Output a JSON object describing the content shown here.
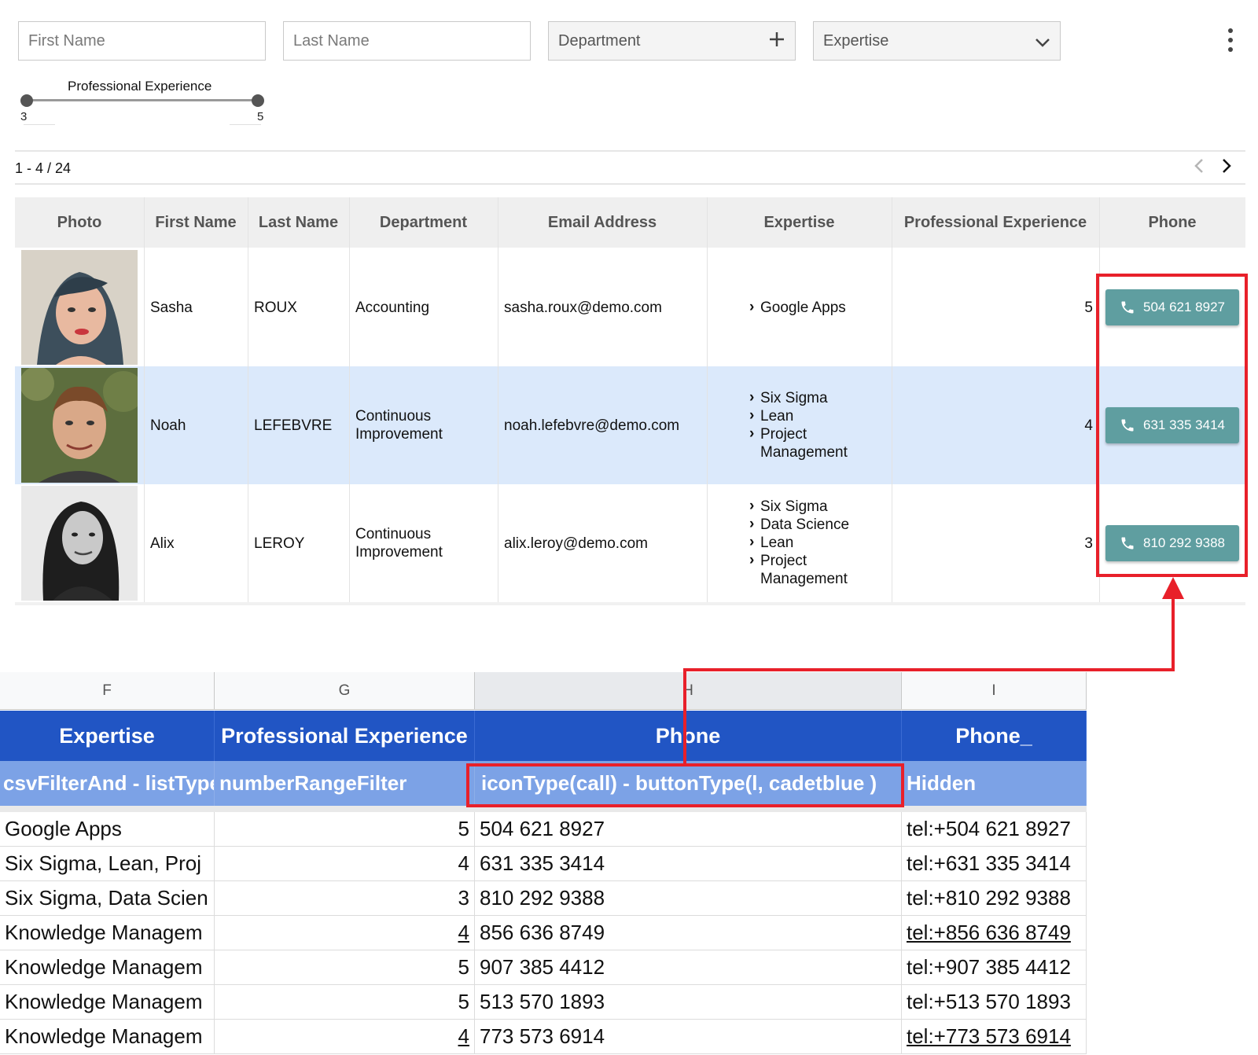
{
  "filters": {
    "first_name_placeholder": "First Name",
    "last_name_placeholder": "Last Name",
    "department_label": "Department",
    "department_icon": "plus-icon",
    "expertise_label": "Expertise",
    "expertise_icon": "chevron-down-icon",
    "menu_icon": "more-vert-icon"
  },
  "range_filter": {
    "title": "Professional Experience",
    "min": "3",
    "max": "5"
  },
  "pagination": {
    "summary": "1 - 4 / 24"
  },
  "table": {
    "headers": [
      "Photo",
      "First Name",
      "Last Name",
      "Department",
      "Email Address",
      "Expertise",
      "Professional Experience",
      "Phone"
    ],
    "rows": [
      {
        "first": "Sasha",
        "last": "ROUX",
        "department": "Accounting",
        "email": "sasha.roux@demo.com",
        "expertise": [
          "Google Apps"
        ],
        "experience": "5",
        "phone": "504 621 8927",
        "selected": false
      },
      {
        "first": "Noah",
        "last": "LEFEBVRE",
        "department": "Continuous Improvement",
        "email": "noah.lefebvre@demo.com",
        "expertise": [
          "Six Sigma",
          "Lean",
          "Project Management"
        ],
        "experience": "4",
        "phone": "631 335 3414",
        "selected": true
      },
      {
        "first": "Alix",
        "last": "LEROY",
        "department": "Continuous Improvement",
        "email": "alix.leroy@demo.com",
        "expertise": [
          "Six Sigma",
          "Data Science",
          "Lean",
          "Project Management"
        ],
        "experience": "3",
        "phone": "810 292 9388",
        "selected": false
      }
    ]
  },
  "sheet": {
    "columns": [
      "F",
      "G",
      "H",
      "I"
    ],
    "headers": [
      "Expertise",
      "Professional Experience",
      "Phone",
      "Phone_"
    ],
    "config": [
      "csvFilterAnd - listType",
      "numberRangeFilter",
      "iconType(call) - buttonType(l, cadetblue )",
      "Hidden"
    ],
    "rows": [
      [
        "Google Apps",
        "5",
        "504 621 8927",
        "tel:+504 621 8927"
      ],
      [
        "Six Sigma, Lean, Proj",
        "4",
        "631 335 3414",
        "tel:+631 335 3414"
      ],
      [
        "Six Sigma, Data Scien",
        "3",
        "810 292 9388",
        "tel:+810 292 9388"
      ],
      [
        "Knowledge Managem",
        "4",
        "856 636 8749",
        "tel:+856 636 8749"
      ],
      [
        "Knowledge Managem",
        "5",
        "907 385 4412",
        "tel:+907 385 4412"
      ],
      [
        "Knowledge Managem",
        "5",
        "513 570 1893",
        "tel:+513 570 1893"
      ],
      [
        "Knowledge Managem",
        "4",
        "773 573 6914",
        "tel:+773 573 6914"
      ]
    ]
  },
  "colors": {
    "button": "#5f9ea0",
    "selected_row": "#dbe9fb",
    "sheet_header": "#2155c4",
    "sheet_config": "#7ca2e6",
    "annotation": "#e8202a"
  }
}
